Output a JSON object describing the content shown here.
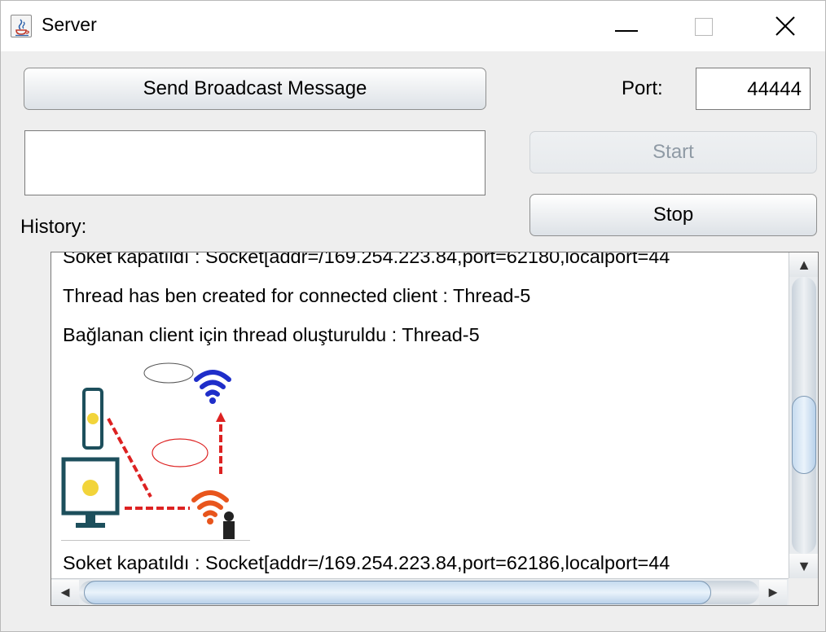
{
  "window": {
    "title": "Server",
    "icon": "java-cup-icon"
  },
  "controls": {
    "broadcast_label": "Send Broadcast Message",
    "port_label": "Port:",
    "port_value": "44444",
    "message_value": "",
    "start_label": "Start",
    "start_enabled": false,
    "stop_label": "Stop",
    "history_label": "History:"
  },
  "history": {
    "lines": [
      "Soket kapatıldı : Socket[addr=/169.254.223.84,port=62180,localport=44",
      "Thread has ben created for connected client : Thread-5",
      "Bağlanan client için thread oluşturuldu : Thread-5",
      "Soket kapatıldı : Socket[addr=/169.254.223.84,port=62186,localport=44"
    ],
    "image_icon": "network-diagram-image"
  },
  "colors": {
    "window_bg": "#eeeeee",
    "button_border": "#8e8f8f",
    "disabled_text": "#8f9aa5",
    "scroll_thumb": "#c6dbef"
  }
}
